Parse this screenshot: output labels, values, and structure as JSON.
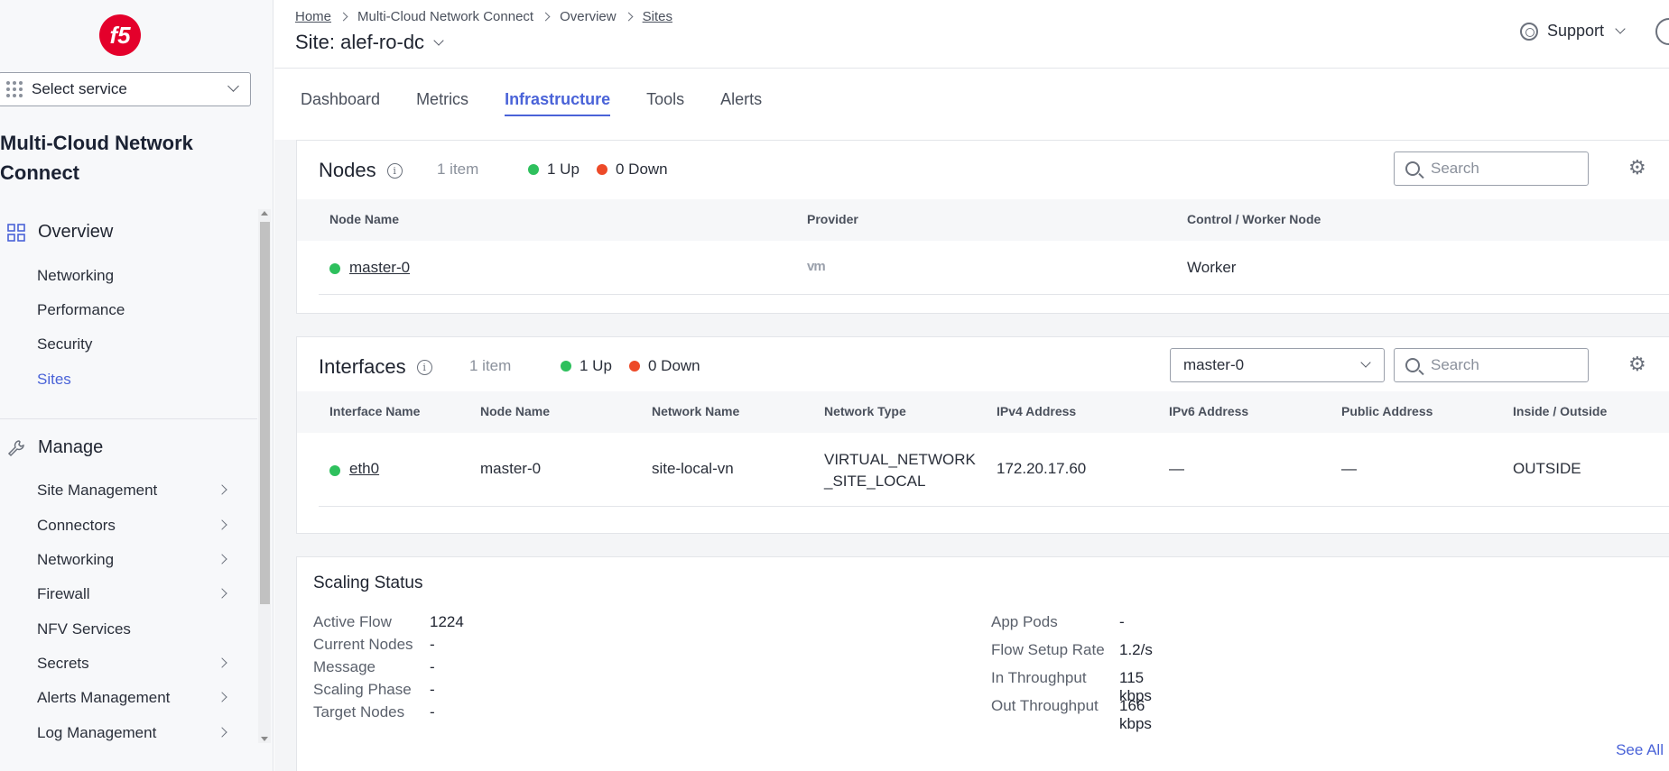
{
  "sidebar": {
    "logo_text": "f5",
    "service_select": "Select service",
    "app_title": "Multi-Cloud Network Connect",
    "overview": {
      "label": "Overview",
      "items": [
        "Networking",
        "Performance",
        "Security",
        "Sites"
      ],
      "active": "Sites"
    },
    "manage": {
      "label": "Manage",
      "items": [
        "Site Management",
        "Connectors",
        "Networking",
        "Firewall",
        "NFV Services",
        "Secrets",
        "Alerts Management",
        "Log Management"
      ]
    }
  },
  "header": {
    "breadcrumb": [
      "Home",
      "Multi-Cloud Network Connect",
      "Overview",
      "Sites"
    ],
    "title": "Site: alef-ro-dc",
    "support": "Support"
  },
  "tabs": [
    "Dashboard",
    "Metrics",
    "Infrastructure",
    "Tools",
    "Alerts"
  ],
  "active_tab": "Infrastructure",
  "nodes": {
    "title": "Nodes",
    "count": "1 item",
    "up": "1 Up",
    "down": "0 Down",
    "search_placeholder": "Search",
    "columns": [
      "Node Name",
      "Provider",
      "Control / Worker Node"
    ],
    "rows": [
      {
        "name": "master-0",
        "provider": "vm",
        "role": "Worker",
        "status_color": "#2ec05d"
      }
    ]
  },
  "interfaces": {
    "title": "Interfaces",
    "count": "1 item",
    "up": "1 Up",
    "down": "0 Down",
    "node_select": "master-0",
    "search_placeholder": "Search",
    "columns": [
      "Interface Name",
      "Node Name",
      "Network Name",
      "Network Type",
      "IPv4 Address",
      "IPv6 Address",
      "Public Address",
      "Inside / Outside"
    ],
    "rows": [
      {
        "interface": "eth0",
        "node": "master-0",
        "network": "site-local-vn",
        "type_line1": "VIRTUAL_NETWORK",
        "type_line2": "_SITE_LOCAL",
        "ipv4": "172.20.17.60",
        "ipv6": "—",
        "public": "—",
        "side": "OUTSIDE"
      }
    ]
  },
  "scaling": {
    "title": "Scaling Status",
    "left": [
      {
        "k": "Active Flow",
        "v": "1224"
      },
      {
        "k": "Current Nodes",
        "v": "-"
      },
      {
        "k": "Message",
        "v": "-"
      },
      {
        "k": "Scaling Phase",
        "v": "-"
      },
      {
        "k": "Target Nodes",
        "v": "-"
      }
    ],
    "right": [
      {
        "k": "App Pods",
        "v": "-"
      },
      {
        "k": "Flow Setup Rate",
        "v": "1.2/s"
      },
      {
        "k": "In Throughput",
        "v": "115 kbps"
      },
      {
        "k": "Out Throughput",
        "v": "166 kbps"
      }
    ],
    "see_all": "See All"
  },
  "colors": {
    "accent": "#4a63d8",
    "up": "#2ec05d",
    "down": "#ed4a28",
    "logo": "#e4002b"
  }
}
